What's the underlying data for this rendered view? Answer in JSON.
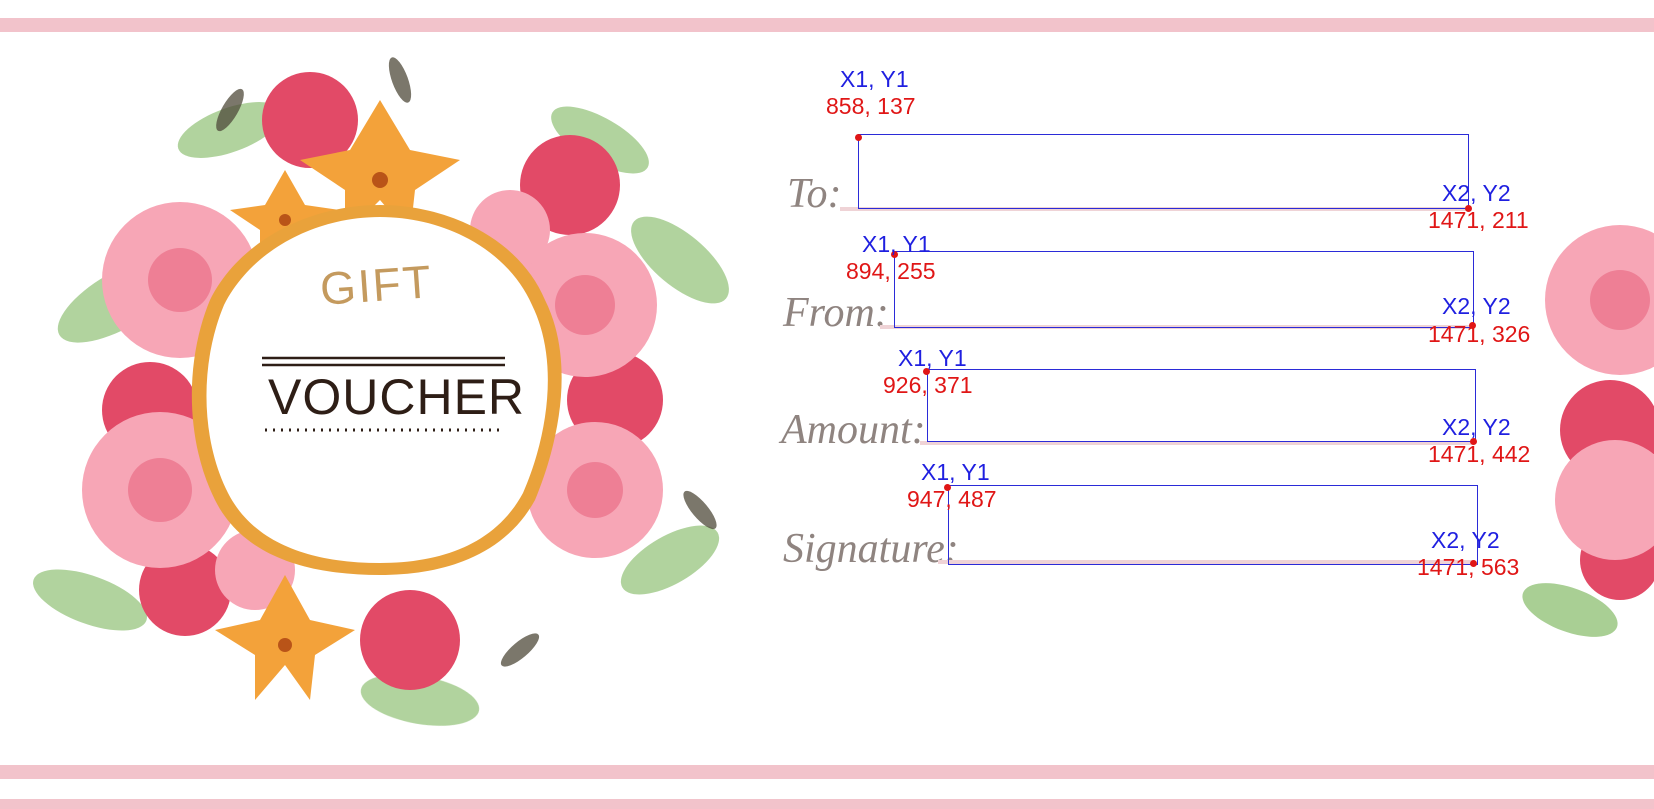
{
  "voucher": {
    "gift": "GIFT",
    "voucher": "VOUCHER"
  },
  "fields": [
    {
      "label": "To:",
      "p1_label": "X1, Y1",
      "p1_coords": "858, 137",
      "p2_label": "X2, Y2",
      "p2_coords": "1471, 211"
    },
    {
      "label": "From:",
      "p1_label": "X1, Y1",
      "p1_coords": "894, 255",
      "p2_label": "X2, Y2",
      "p2_coords": "1471, 326"
    },
    {
      "label": "Amount:",
      "p1_label": "X1, Y1",
      "p1_coords": "926, 371",
      "p2_label": "X2, Y2",
      "p2_coords": "1471, 442"
    },
    {
      "label": "Signature:",
      "p1_label": "X1, Y1",
      "p1_coords": "947, 487",
      "p2_label": "X2, Y2",
      "p2_coords": "1471, 563"
    }
  ],
  "colors": {
    "stripe": "#f2c3cb",
    "box": "#2b2bd8",
    "coords": "#e01616",
    "point_label": "#1f1fe0"
  }
}
